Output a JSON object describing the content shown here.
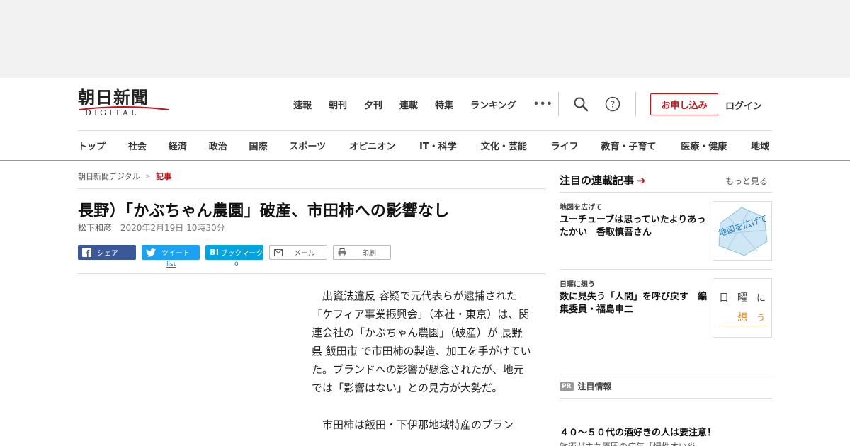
{
  "masthead": {
    "logo_main": "朝日新聞",
    "logo_sub": "DIGITAL",
    "nav": [
      "速報",
      "朝刊",
      "夕刊",
      "連載",
      "特集",
      "ランキング"
    ],
    "more": "•••",
    "apply_label": "お申し込み",
    "login_label": "ログイン",
    "accent_color": "#c4131b"
  },
  "categories": [
    "トップ",
    "社会",
    "経済",
    "政治",
    "国際",
    "スポーツ",
    "オピニオン",
    "IT・科学",
    "文化・芸能",
    "ライフ",
    "教育・子育て",
    "医療・健康",
    "地域"
  ],
  "breadcrumb": {
    "home": "朝日新聞デジタル",
    "separator": ">",
    "current": "記事"
  },
  "article": {
    "headline": "長野）「かぶちゃん農園」破産、市田柿への影響なし",
    "author": "松下和彦",
    "date": "2020年2月19日 10時30分",
    "share": {
      "facebook": "シェア",
      "twitter": "ツイート",
      "twitter_count": "list",
      "hatena": "ブックマーク",
      "hatena_prefix": "B!",
      "hatena_count": "0",
      "mail": "メール",
      "print": "印刷"
    },
    "p1": {
      "link1": "出資法違反",
      "t1": " 容疑で元代表らが逮捕された「ケフィア事業振興会」（本社・東京）は、関連会社の「かぶちゃん農園」（破産）が ",
      "link2": "長野県",
      "t2": " ",
      "link3": "飯田市",
      "t3": " で市田柿の製造、加工を手がけていた。ブランドへの影響が懸念されたが、地元では「影響はない」との見方が大勢だ。"
    },
    "p2": "市田柿は飯田・下伊那地域特産のブラン"
  },
  "sidebar": {
    "title": "注目の連載記事",
    "more": "もっと見る",
    "cards": [
      {
        "kicker": "地図を広げて",
        "title": "ユーチューブは思っていたよりあったかい　香取慎吾さん",
        "thumb_text": "地図を広げて"
      },
      {
        "kicker": "日曜に想う",
        "title": "数に見失う「人間」を呼び戻す　編集委員・福島申二",
        "thumb_chars": [
          "日",
          "曜",
          "に",
          "想",
          "う"
        ]
      }
    ],
    "pr_badge": "PR",
    "pr_label": "注目情報",
    "pr_headline": "４０～５０代の酒好きの人は要注意！",
    "pr_sub": "飲酒が主な原因の病気「慢性すい炎"
  }
}
